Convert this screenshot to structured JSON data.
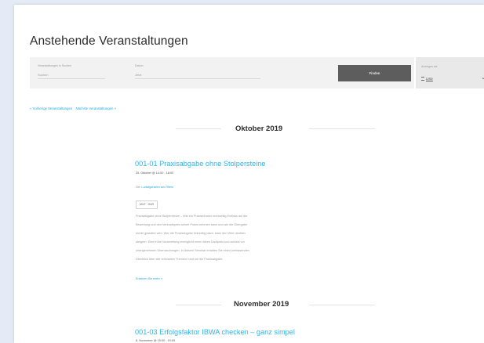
{
  "page_title": "Anstehende Veranstaltungen",
  "filters": {
    "search": {
      "label": "Veranstaltungen in Suchen",
      "placeholder": "Suchen"
    },
    "date": {
      "label": "Datum",
      "placeholder": "Jetzt"
    },
    "find_button_label": "Finden"
  },
  "view": {
    "label": "Anzeigen als",
    "selected": "Liste"
  },
  "nav": {
    "previous": "« Vorherige Veranstaltungen",
    "next": "Nächste Veranstaltungen »"
  },
  "months": [
    {
      "label": "Oktober 2019"
    },
    {
      "label": "November 2019"
    }
  ],
  "events": [
    {
      "title": "001-01 Praxisabgabe ohne Stolpersteine",
      "datetime": "25. Oktober @ 14:00 - 18:00",
      "meta_prefix": "Ort:",
      "meta_link": "Ludwigshafen am Rhein",
      "tag": "MVZ · GbR",
      "description_lines": [
        "Praxisabgabe ohne Stolpersteine – Wie ein Praxisinhaber rechtzeitig Einfluss auf die",
        "Bewertung und den Verkaufspreis seiner Praxis nehmen kann und wie die Übergabe",
        "sicher gestaltet wird. Wer die Praxisabgabe frühzeitig plant, kann den Wert deutlich",
        "steigern. Eine frühe Vorbereitung ermöglicht einen fairen Kaufpreis und schützt vor",
        "unangenehmen Überraschungen. In diesem Seminar erhalten Sie einen umfassenden",
        "Überblick über alle relevanten Themen rund um die Praxisabgabe."
      ],
      "read_more": "Erfahren Sie mehr »"
    },
    {
      "title": "001-03 Erfolgsfaktor IBWA checken – ganz simpel",
      "datetime": "8. November @ 15:00 - 19:00"
    }
  ]
}
